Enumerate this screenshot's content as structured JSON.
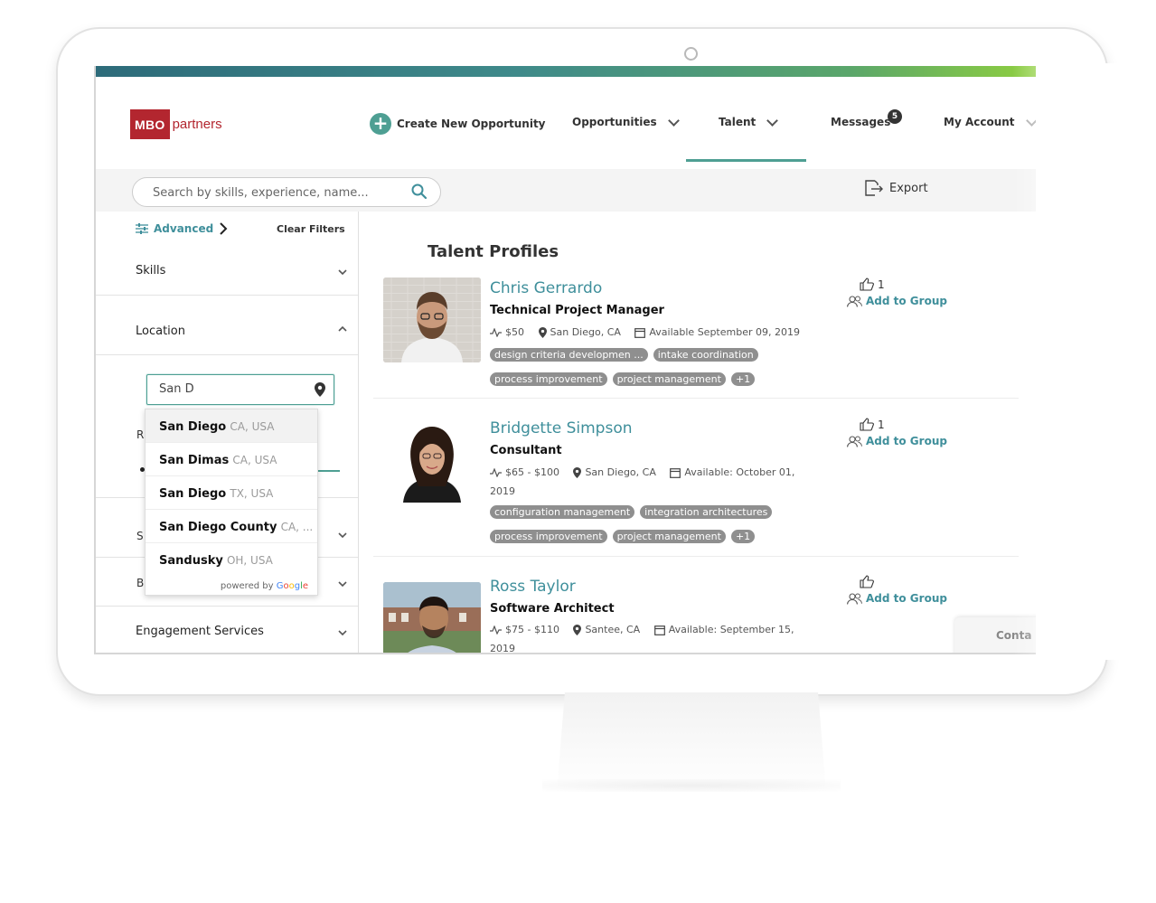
{
  "header": {
    "logo_box": "MBO",
    "logo_text": "partners",
    "create_label": "Create New Opportunity",
    "nav": [
      "Opportunities",
      "Talent",
      "Messages",
      "My Account"
    ],
    "messages_count": "5"
  },
  "search": {
    "placeholder": "Search by skills, experience, name...",
    "export_label": "Export"
  },
  "sidebar": {
    "advanced_label": "Advanced",
    "clear_label": "Clear Filters",
    "sections": [
      "Skills",
      "Location",
      "Engagement Services"
    ],
    "partial_labels": [
      "R",
      "S",
      "B"
    ],
    "location_value": "San D",
    "suggestions": [
      {
        "bold": "San Diego",
        "sub": "CA, USA"
      },
      {
        "bold": "San Dimas",
        "sub": "CA, USA"
      },
      {
        "bold": "San Diego",
        "sub": "TX, USA"
      },
      {
        "bold": "San Diego County",
        "sub": "CA, ..."
      },
      {
        "bold": "Sandusky",
        "sub": "OH, USA"
      }
    ],
    "powered_by": "powered by",
    "google": [
      "G",
      "o",
      "o",
      "g",
      "l",
      "e"
    ]
  },
  "main": {
    "title": "Talent Profiles",
    "add_group_label": "Add to Group",
    "contact_label": "Conta",
    "profiles": [
      {
        "name": "Chris Gerrardo",
        "role": "Technical Project Manager",
        "rate": "$50",
        "location": "San Diego, CA",
        "available": "Available September 09, 2019",
        "likes": "1",
        "tags": [
          "design criteria developmen ...",
          "intake coordination",
          "process improvement",
          "project management",
          "+1"
        ]
      },
      {
        "name": "Bridgette Simpson",
        "role": "Consultant",
        "rate": "$65 - $100",
        "location": "San Diego, CA",
        "available": "Available: October 01, 2019",
        "likes": "1",
        "tags": [
          "configuration management",
          "integration architectures",
          "process improvement",
          "project management",
          "+1"
        ]
      },
      {
        "name": "Ross Taylor",
        "role": "Software Architect",
        "rate": "$75 - $110",
        "location": "Santee, CA",
        "available": "Available: September 15, 2019",
        "likes": "",
        "tags": []
      }
    ]
  },
  "colors": {
    "accent": "#4e9f93",
    "link": "#3f8f9b",
    "brand": "#b3262f",
    "tag": "#8f8f8f"
  }
}
